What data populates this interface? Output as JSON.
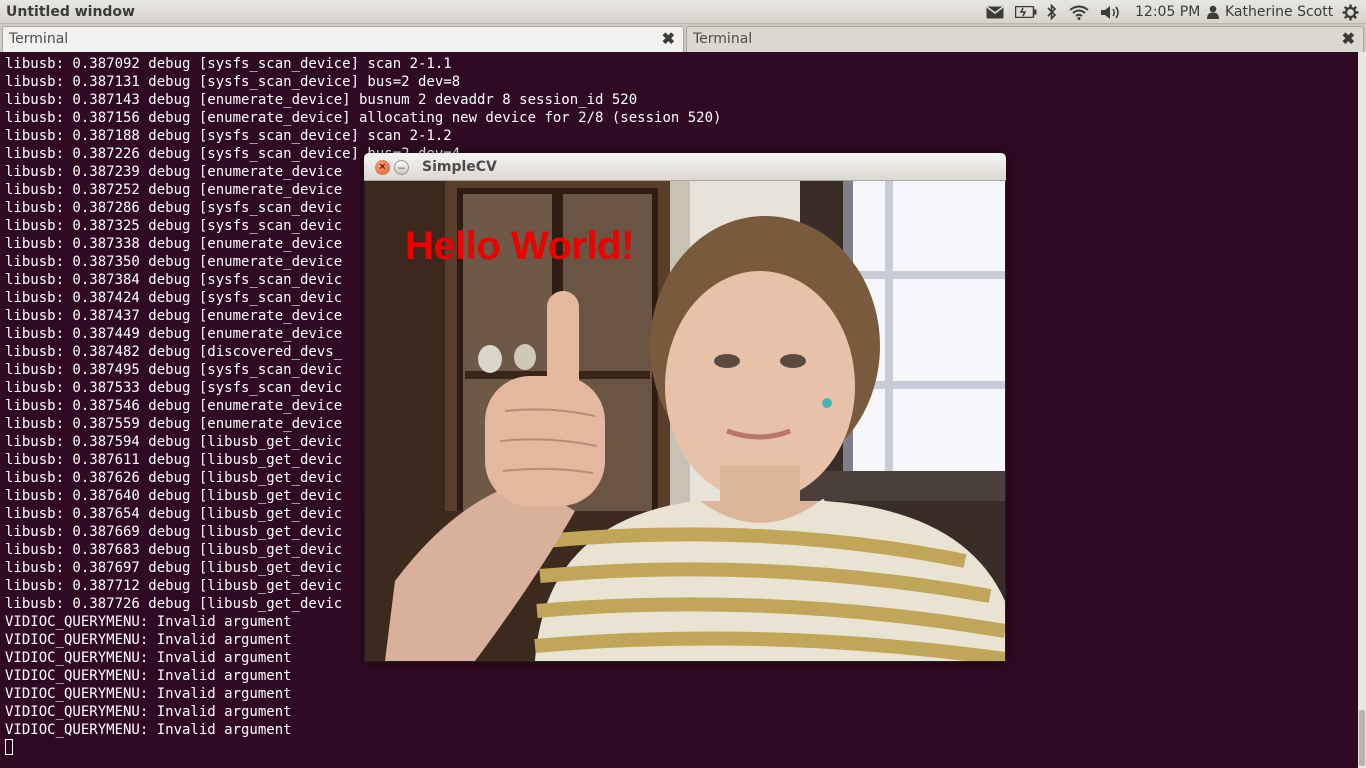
{
  "top_panel": {
    "window_title": "Untitled window",
    "indicators": [
      "mail-icon",
      "battery-icon",
      "bluetooth-icon",
      "wifi-icon",
      "volume-icon"
    ],
    "clock": "12:05 PM",
    "user": "Katherine Scott",
    "session_icon": "gear-icon"
  },
  "tabs": [
    {
      "label": "Terminal",
      "active": true
    },
    {
      "label": "Terminal",
      "active": false
    }
  ],
  "terminal": {
    "lines": [
      "libusb: 0.387092 debug [sysfs_scan_device] scan 2-1.1",
      "libusb: 0.387131 debug [sysfs_scan_device] bus=2 dev=8",
      "libusb: 0.387143 debug [enumerate_device] busnum 2 devaddr 8 session_id 520",
      "libusb: 0.387156 debug [enumerate_device] allocating new device for 2/8 (session 520)",
      "libusb: 0.387188 debug [sysfs_scan_device] scan 2-1.2",
      "libusb: 0.387226 debug [sysfs_scan_device] bus=2 dev=4",
      "libusb: 0.387239 debug [enumerate_device",
      "libusb: 0.387252 debug [enumerate_device",
      "libusb: 0.387286 debug [sysfs_scan_devic",
      "libusb: 0.387325 debug [sysfs_scan_devic",
      "libusb: 0.387338 debug [enumerate_device",
      "libusb: 0.387350 debug [enumerate_device",
      "libusb: 0.387384 debug [sysfs_scan_devic",
      "libusb: 0.387424 debug [sysfs_scan_devic",
      "libusb: 0.387437 debug [enumerate_device",
      "libusb: 0.387449 debug [enumerate_device",
      "libusb: 0.387482 debug [discovered_devs_",
      "libusb: 0.387495 debug [sysfs_scan_devic",
      "libusb: 0.387533 debug [sysfs_scan_devic",
      "libusb: 0.387546 debug [enumerate_device",
      "libusb: 0.387559 debug [enumerate_device",
      "libusb: 0.387594 debug [libusb_get_devic",
      "libusb: 0.387611 debug [libusb_get_devic",
      "libusb: 0.387626 debug [libusb_get_devic",
      "libusb: 0.387640 debug [libusb_get_devic",
      "libusb: 0.387654 debug [libusb_get_devic",
      "libusb: 0.387669 debug [libusb_get_devic",
      "libusb: 0.387683 debug [libusb_get_devic",
      "libusb: 0.387697 debug [libusb_get_devic",
      "libusb: 0.387712 debug [libusb_get_devic",
      "libusb: 0.387726 debug [libusb_get_devic",
      "VIDIOC_QUERYMENU: Invalid argument",
      "VIDIOC_QUERYMENU: Invalid argument",
      "VIDIOC_QUERYMENU: Invalid argument",
      "VIDIOC_QUERYMENU: Invalid argument",
      "VIDIOC_QUERYMENU: Invalid argument",
      "VIDIOC_QUERYMENU: Invalid argument",
      "VIDIOC_QUERYMENU: Invalid argument"
    ]
  },
  "simplecv": {
    "title": "SimpleCV",
    "overlay_text": "Hello World!",
    "overlay_color": "#ee0000"
  },
  "colors": {
    "terminal_bg": "#300a24",
    "terminal_fg": "#ffffff",
    "panel_bg": "#dfdbd2"
  }
}
